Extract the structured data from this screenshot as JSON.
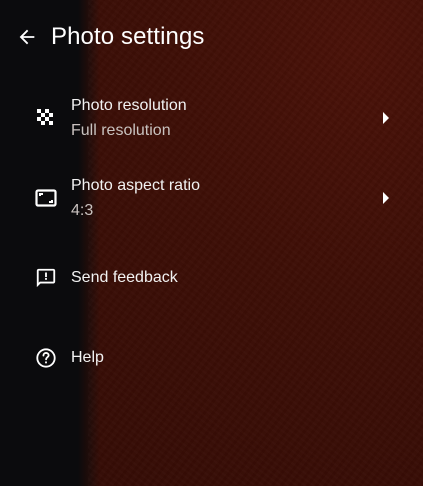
{
  "header": {
    "title": "Photo settings"
  },
  "items": [
    {
      "label": "Photo resolution",
      "value": "Full resolution",
      "icon": "checkerboard-icon"
    },
    {
      "label": "Photo aspect ratio",
      "value": "4:3",
      "icon": "aspect-ratio-icon"
    },
    {
      "label": "Send feedback",
      "icon": "feedback-icon"
    },
    {
      "label": "Help",
      "icon": "help-icon"
    }
  ],
  "colors": {
    "background_left": "#0b0b0d",
    "background_right": "#3d0e06",
    "text_primary": "#f2f2f2",
    "text_secondary": "#c9c2bf"
  }
}
